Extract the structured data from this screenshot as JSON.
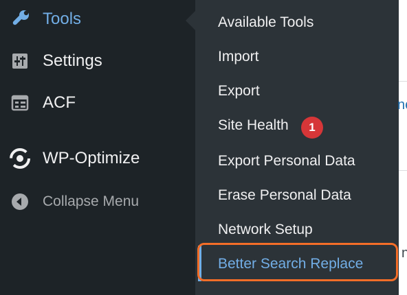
{
  "sidebar": {
    "items": [
      {
        "label": "Tools",
        "icon": "wrench-icon",
        "active": true
      },
      {
        "label": "Settings",
        "icon": "settings-sliders-icon"
      },
      {
        "label": "ACF",
        "icon": "acf-table-icon"
      },
      {
        "label": "WP-Optimize",
        "icon": "wp-optimize-icon"
      },
      {
        "label": "Collapse Menu",
        "icon": "collapse-arrow-icon"
      }
    ]
  },
  "submenu": {
    "items": [
      {
        "label": "Available Tools"
      },
      {
        "label": "Import"
      },
      {
        "label": "Export"
      },
      {
        "label": "Site Health",
        "badge": "1"
      },
      {
        "label": "Export Personal Data"
      },
      {
        "label": "Erase Personal Data"
      },
      {
        "label": "Network Setup"
      },
      {
        "label": "Better Search Replace",
        "current": true
      }
    ]
  },
  "content_edge": {
    "fragment_1": "ne",
    "fragment_2": "ne"
  },
  "colors": {
    "sidebar_bg": "#1d2327",
    "submenu_bg": "#2c3338",
    "accent": "#72aee6",
    "badge": "#d63638",
    "highlight": "#f56e28"
  }
}
